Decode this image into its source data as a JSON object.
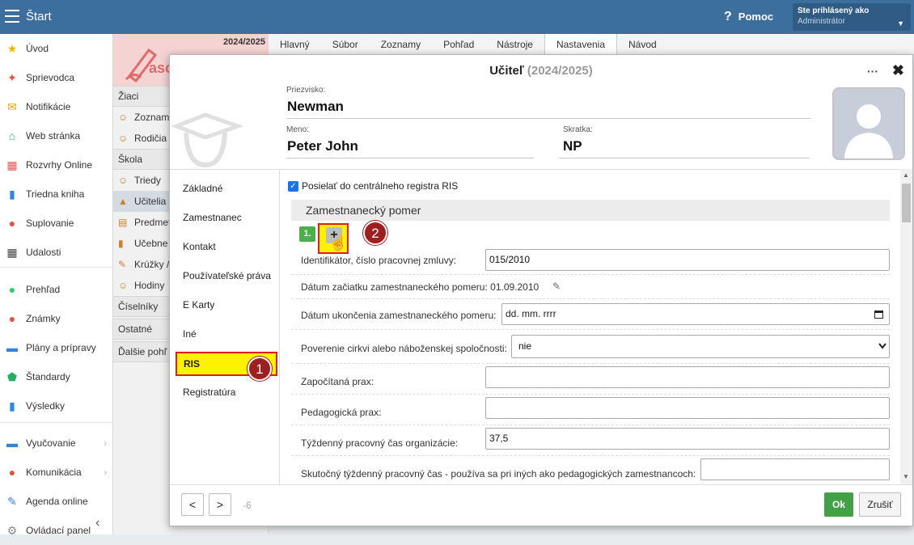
{
  "topbar": {
    "title": "Štart",
    "help": "Pomoc",
    "help_icon": "?",
    "user_line1": "Ste prihlásený ako",
    "user_line2": "Administrátor"
  },
  "sidebar": {
    "items": [
      {
        "label": "Úvod",
        "icon": "★",
        "color": "#f5b400"
      },
      {
        "label": "Sprievodca",
        "icon": "✦",
        "color": "#e0533d"
      },
      {
        "label": "Notifikácie",
        "icon": "✉",
        "color": "#f39c12"
      },
      {
        "label": "Web stránka",
        "icon": "⌂",
        "color": "#27ae60"
      },
      {
        "label": "Rozvrhy Online",
        "icon": "▦",
        "color": "#e05656"
      },
      {
        "label": "Triedna kniha",
        "icon": "▮",
        "color": "#2e86de"
      },
      {
        "label": "Suplovanie",
        "icon": "●",
        "color": "#e0533d"
      },
      {
        "label": "Udalosti",
        "icon": "▦",
        "color": "#444444"
      },
      {
        "label": "Prehľad",
        "icon": "●",
        "color": "#2ecc71"
      },
      {
        "label": "Známky",
        "icon": "●",
        "color": "#e0533d"
      },
      {
        "label": "Plány a prípravy",
        "icon": "▬",
        "color": "#2e86de"
      },
      {
        "label": "Štandardy",
        "icon": "⬟",
        "color": "#27ae60"
      },
      {
        "label": "Výsledky",
        "icon": "▮",
        "color": "#2e86de"
      },
      {
        "label": "Vyučovanie",
        "icon": "▬",
        "color": "#2e86de"
      },
      {
        "label": "Komunikácia",
        "icon": "●",
        "color": "#e0533d"
      },
      {
        "label": "Agenda online",
        "icon": "✎",
        "color": "#2e86de"
      },
      {
        "label": "Ovládací panel",
        "icon": "⚙",
        "color": "#888888"
      }
    ]
  },
  "secondcol": {
    "year": "2024/2025",
    "logo_text": "asc",
    "items": [
      {
        "label": "Žiaci",
        "type": "head"
      },
      {
        "label": "Zoznam",
        "type": "item",
        "icon": "☺"
      },
      {
        "label": "Rodičia",
        "type": "item",
        "icon": "☺"
      },
      {
        "label": "Škola",
        "type": "head"
      },
      {
        "label": "Triedy",
        "type": "item",
        "icon": "☺"
      },
      {
        "label": "Učitelia -",
        "type": "active",
        "icon": "▲"
      },
      {
        "label": "Predmet",
        "type": "item",
        "icon": "▤"
      },
      {
        "label": "Učebne",
        "type": "item",
        "icon": "▮"
      },
      {
        "label": "Krúžky /",
        "type": "item",
        "icon": "✎"
      },
      {
        "label": "Hodiny",
        "type": "item",
        "icon": "☺"
      },
      {
        "label": "Číselníky",
        "type": "head"
      },
      {
        "label": "Ostatné",
        "type": "head"
      },
      {
        "label": "Ďalšie pohľ",
        "type": "head"
      }
    ]
  },
  "menubar": {
    "items": [
      "Hlavný",
      "Súbor",
      "Zoznamy",
      "Pohľad",
      "Nástroje",
      "Nastavenia",
      "Návod"
    ],
    "active": "Nastavenia"
  },
  "dialog": {
    "title": "Učiteľ",
    "year": "(2024/2025)",
    "more": "···",
    "close": "✖",
    "surname_label": "Priezvisko:",
    "surname": "Newman",
    "name_label": "Meno:",
    "name": "Peter John",
    "abbr_label": "Skratka:",
    "abbr": "NP",
    "tabs": [
      "Základné",
      "Zamestnanec",
      "Kontakt",
      "Používateľské práva",
      "E Karty",
      "Iné",
      "RIS",
      "Registratúra"
    ],
    "badge1": "1",
    "badge2": "2",
    "checkbox_label": "Posielať do centrálneho registra RIS",
    "section_title": "Zamestnanecký pomer",
    "record_num": "1.",
    "plus": "+",
    "fields": {
      "identifier_label": "Identifikátor, číslo pracovnej zmluvy:",
      "identifier_value": "015/2010",
      "start_label": "Dátum začiatku zamestnaneckého pomeru:",
      "start_value": "01.09.2010",
      "end_label": "Dátum ukončenia zamestnaneckého pomeru:",
      "end_placeholder": "dd. mm. rrrr",
      "church_label": "Poverenie cirkvi alebo náboženskej spoločnosti:",
      "church_value": "nie",
      "counted_label": "Započítaná prax:",
      "counted_value": "",
      "ped_label": "Pedagogická prax:",
      "ped_value": "",
      "weekly_label": "Týždenný pracovný čas organizácie:",
      "weekly_value": "37,5",
      "actual_label": "Skutočný týždenný pracovný čas - používa sa pri iných ako pedagogických zamestnancoch:",
      "actual_value": ""
    },
    "footer": {
      "prev": "<",
      "next": ">",
      "page": "-6",
      "ok": "Ok",
      "cancel": "Zrušiť"
    }
  }
}
